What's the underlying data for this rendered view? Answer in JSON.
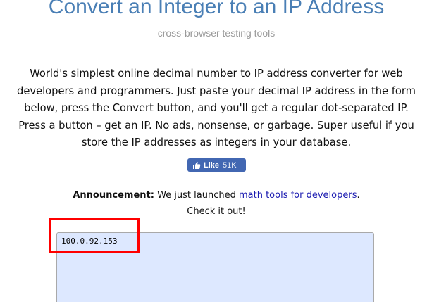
{
  "header": {
    "title": "Convert an Integer to an IP Address",
    "subtitle": "cross-browser testing tools"
  },
  "intro": {
    "text": "World's simplest online decimal number to IP address converter for web developers and programmers. Just paste your decimal IP address in the form below, press the Convert button, and you'll get a regular dot-separated IP. Press a button – get an IP. No ads, nonsense, or garbage. Super useful if you store the IP addresses as integers in your database."
  },
  "like_button": {
    "label": "Like",
    "count": "51K",
    "icon": "thumbs-up-icon"
  },
  "announcement": {
    "label": "Announcement:",
    "text_before": " We just launched ",
    "link_text": "math tools for developers",
    "text_after": ".",
    "line2": "Check it out!"
  },
  "input": {
    "value": "100.0.92.153"
  },
  "colors": {
    "title": "#4a7fb5",
    "subtitle": "#9a9a9a",
    "like_bg": "#4267b2",
    "input_bg": "#dde8ff",
    "highlight": "#ff0000",
    "link": "#1a1ab0"
  }
}
